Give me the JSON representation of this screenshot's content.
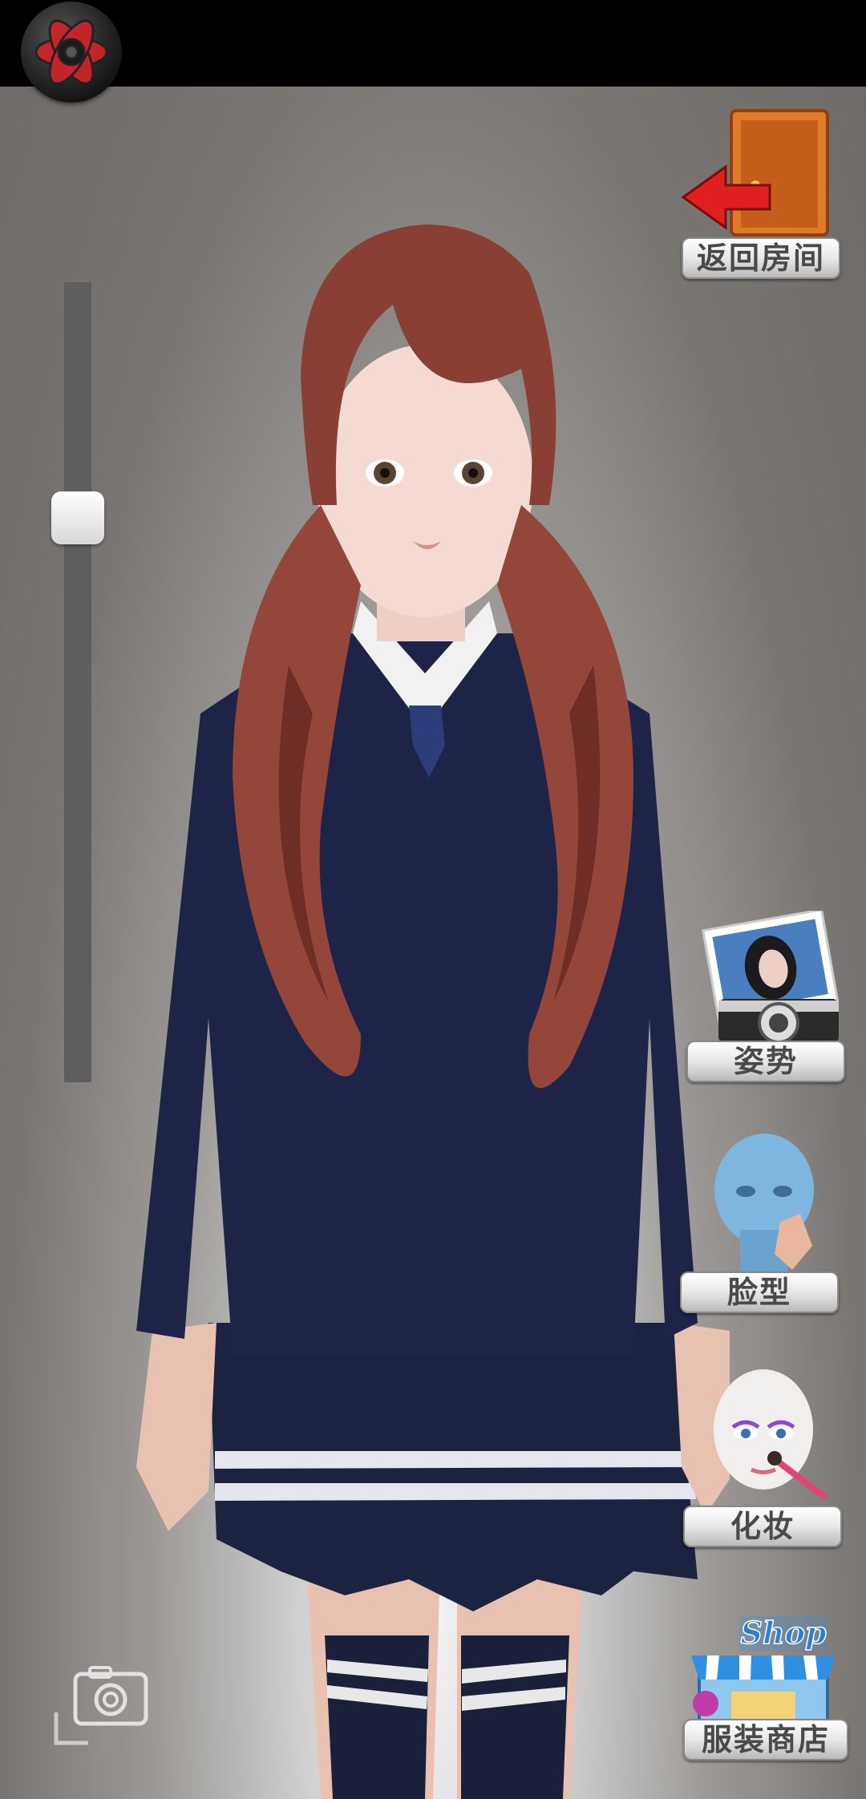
{
  "buttons": {
    "back_room": "返回房间",
    "pose": "姿势",
    "face_shape": "脸型",
    "makeup": "化妆",
    "clothing_shop": "服装商店",
    "shop_sign": "Shop"
  },
  "zoom_slider": {
    "value": 0.28
  },
  "colors": {
    "topbar": "#000000",
    "uniform": "#1d2448",
    "hair": "#8a3f35"
  }
}
